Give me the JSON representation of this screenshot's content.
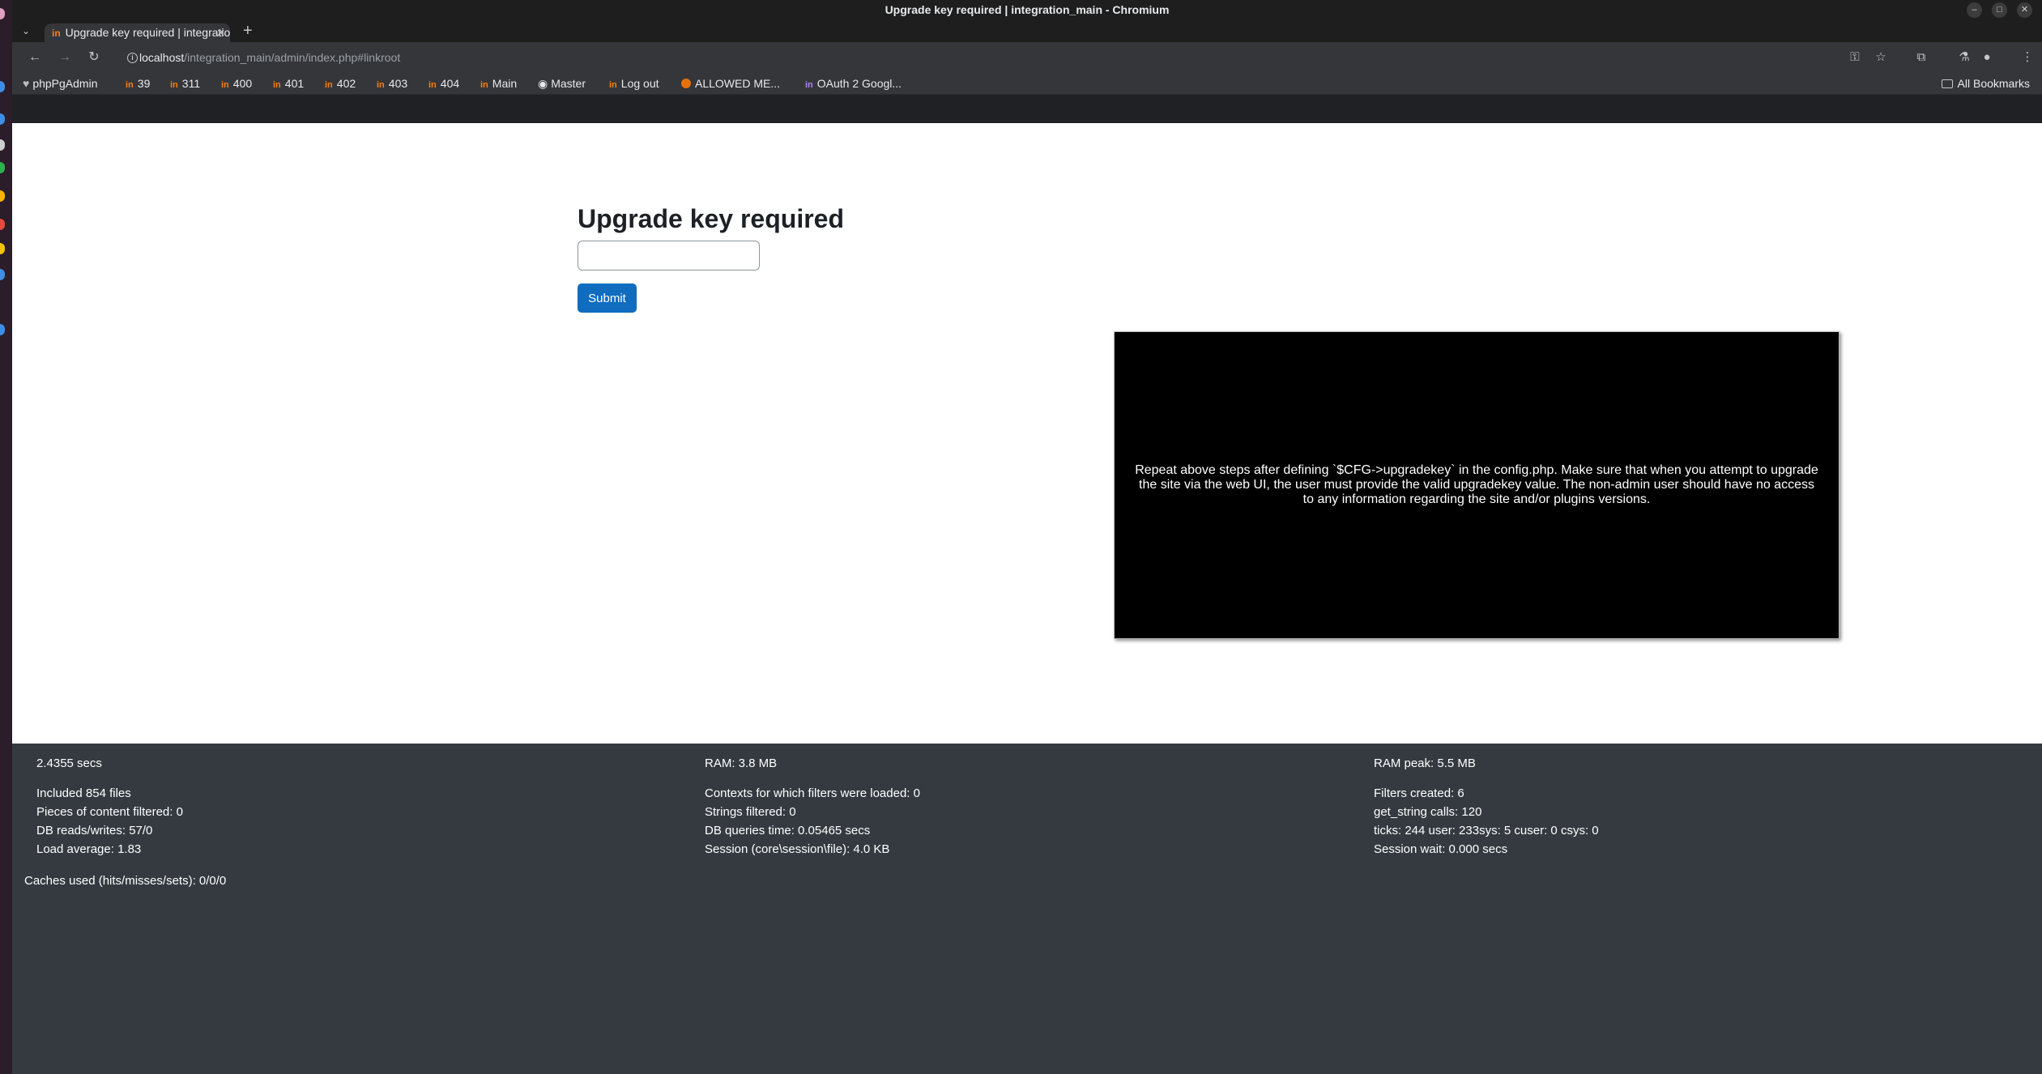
{
  "window": {
    "title": "Upgrade key required | integration_main - Chromium"
  },
  "tab": {
    "title": "Upgrade key required | integration_main",
    "favicon": "in"
  },
  "omnibox": {
    "host": "localhost",
    "path": "/integration_main/admin/index.php#linkroot"
  },
  "bookmarks": {
    "items": [
      {
        "label": "phpPgAdmin",
        "icon": "elephant-icon"
      },
      {
        "label": "39",
        "icon": "moodle-icon"
      },
      {
        "label": "311",
        "icon": "moodle-icon"
      },
      {
        "label": "400",
        "icon": "moodle-icon"
      },
      {
        "label": "401",
        "icon": "moodle-icon"
      },
      {
        "label": "402",
        "icon": "moodle-icon"
      },
      {
        "label": "403",
        "icon": "moodle-icon"
      },
      {
        "label": "404",
        "icon": "moodle-icon"
      },
      {
        "label": "Main",
        "icon": "moodle-icon"
      },
      {
        "label": "Master",
        "icon": "github-icon"
      },
      {
        "label": "Log out",
        "icon": "moodle-icon"
      },
      {
        "label": "ALLOWED ME...",
        "icon": "alert-icon"
      },
      {
        "label": "OAuth 2 Googl...",
        "icon": "oauth-icon"
      }
    ],
    "all_label": "All Bookmarks"
  },
  "page": {
    "heading": "Upgrade key required",
    "input_value": "",
    "submit_label": "Submit",
    "notice": "Repeat above steps after defining `$CFG->upgradekey` in the config.php. Make sure that when you attempt to upgrade the site via the web UI, the user must provide the valid upgradekey value. The non-admin user should have no access to any information regarding the site and/or plugins versions."
  },
  "performance": {
    "col1": [
      "2.4355 secs",
      "Included 854 files",
      "Pieces of content filtered: 0",
      "DB reads/writes: 57/0",
      "Load average: 1.83"
    ],
    "col2": [
      "RAM: 3.8 MB",
      "Contexts for which filters were loaded: 0",
      "Strings filtered: 0",
      "DB queries time: 0.05465 secs",
      "Session (core\\session\\file): 4.0 KB"
    ],
    "col3": [
      "RAM peak: 5.5 MB",
      "Filters created: 6",
      "get_string calls: 120",
      "ticks: 244 user: 233sys: 5 cuser: 0 csys: 0",
      "Session wait: 0.000 secs"
    ],
    "caches": "Caches used (hits/misses/sets): 0/0/0"
  },
  "colors": {
    "accent": "#0f6cbf",
    "moodle_orange": "#f98012",
    "footer_bg": "#343a40"
  }
}
